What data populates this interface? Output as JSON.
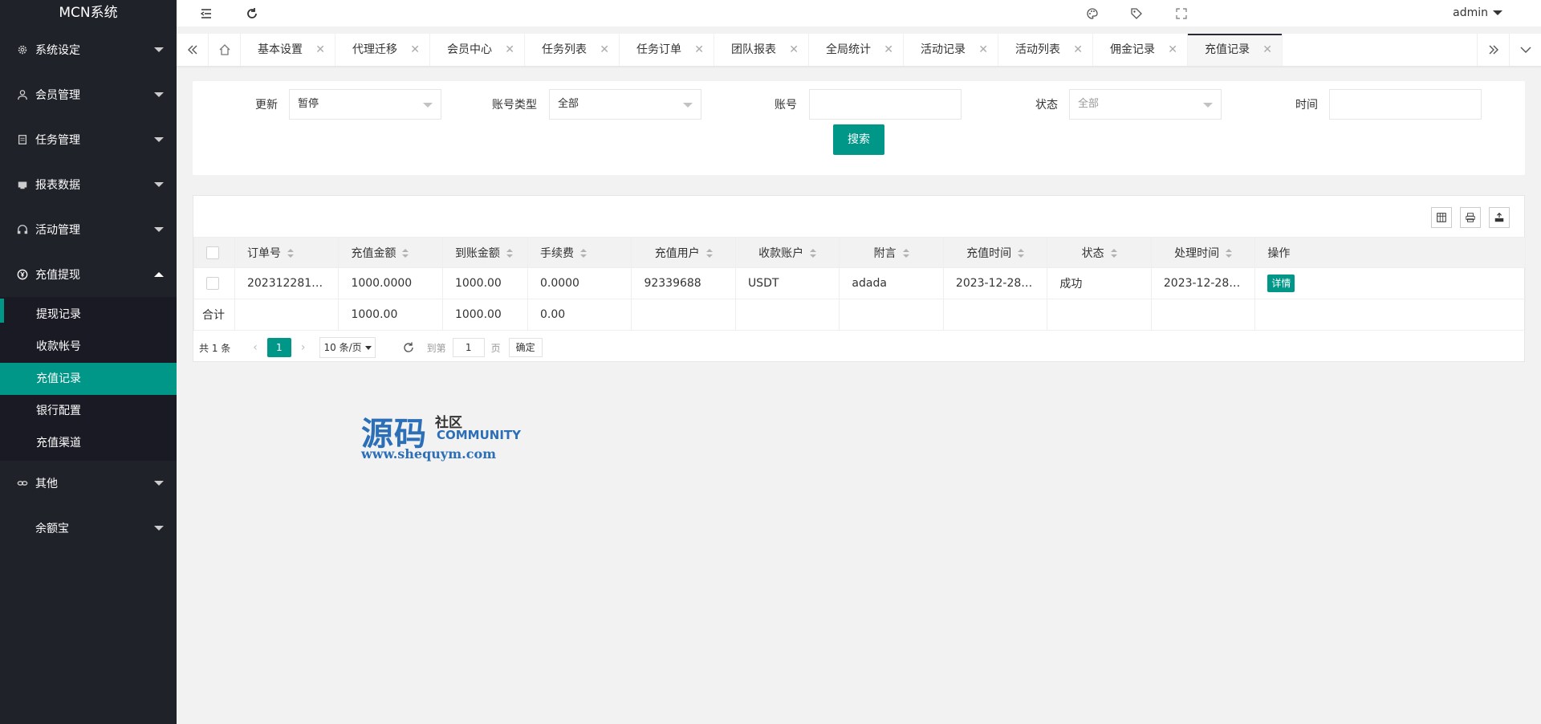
{
  "app": {
    "logo": "MCN系统"
  },
  "sidebar": {
    "items": [
      {
        "label": "系统设定",
        "icon": "gear-icon"
      },
      {
        "label": "会员管理",
        "icon": "user-icon"
      },
      {
        "label": "任务管理",
        "icon": "document-icon"
      },
      {
        "label": "报表数据",
        "icon": "report-icon"
      },
      {
        "label": "活动管理",
        "icon": "headphone-icon"
      },
      {
        "label": "充值提现",
        "icon": "yen-icon",
        "expanded": true
      },
      {
        "label": "其他",
        "icon": "link-icon"
      },
      {
        "label": "余额宝",
        "icon": ""
      }
    ],
    "subitems": [
      "提现记录",
      "收款帐号",
      "充值记录",
      "银行配置",
      "充值渠道"
    ],
    "active_subitem": "充值记录"
  },
  "header": {
    "user": "admin"
  },
  "tabs": [
    {
      "label": "基本设置"
    },
    {
      "label": "代理迁移"
    },
    {
      "label": "会员中心"
    },
    {
      "label": "任务列表"
    },
    {
      "label": "任务订单"
    },
    {
      "label": "团队报表"
    },
    {
      "label": "全局统计"
    },
    {
      "label": "活动记录"
    },
    {
      "label": "活动列表"
    },
    {
      "label": "佣金记录"
    },
    {
      "label": "充值记录",
      "active": true
    }
  ],
  "filters": {
    "update_label": "更新",
    "update_value": "暂停",
    "account_type_label": "账号类型",
    "account_type_value": "全部",
    "account_label": "账号",
    "account_value": "",
    "status_label": "状态",
    "status_value": "全部",
    "time_label": "时间",
    "time_value": "",
    "search_button": "搜索"
  },
  "table": {
    "columns": [
      "订单号",
      "充值金额",
      "到账金额",
      "手续费",
      "充值用户",
      "收款账户",
      "附言",
      "充值时间",
      "状态",
      "处理时间",
      "操作"
    ],
    "rows": [
      {
        "order_no": "2023122813...",
        "amount": "1000.0000",
        "received": "1000.00",
        "fee": "0.0000",
        "user": "92339688",
        "account": "USDT",
        "remark": "adada",
        "recharge_time": "2023-12-28 ...",
        "status": "成功",
        "process_time": "2023-12-28 ...",
        "action": "详情"
      }
    ],
    "total": {
      "label": "合计",
      "amount": "1000.00",
      "received": "1000.00",
      "fee": "0.00"
    }
  },
  "pager": {
    "count": "共 1 条",
    "current_page": "1",
    "page_size": "10 条/页",
    "goto_label": "到第",
    "goto_value": "1",
    "page_label": "页",
    "confirm": "确定"
  },
  "watermark": {
    "big": "源码",
    "small_cn": "社区",
    "small_en": "COMMUNITY",
    "url": "www.shequym.com"
  },
  "colors": {
    "accent": "#009688",
    "sidebar_bg": "#20222a",
    "submenu_bg": "#191a23"
  }
}
